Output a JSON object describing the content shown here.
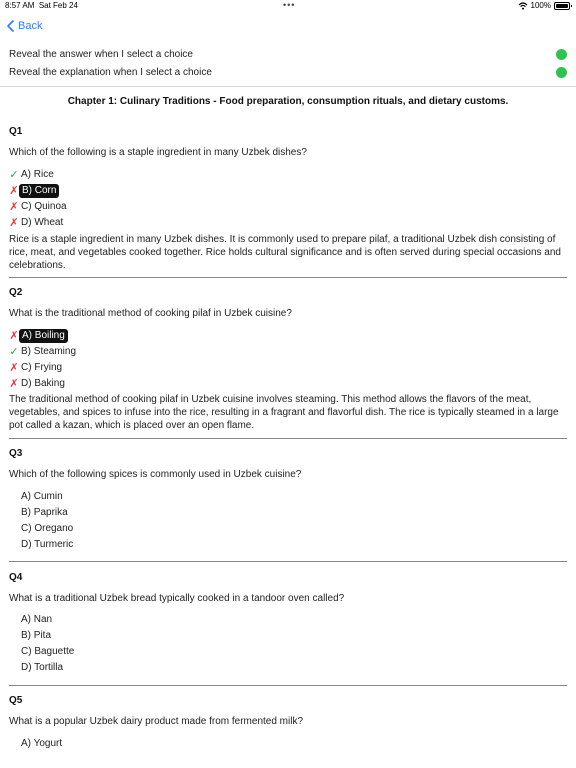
{
  "status": {
    "time": "8:57 AM",
    "date": "Sat Feb 24",
    "battery": "100%",
    "icons": [
      "wifi-icon",
      "battery-icon"
    ]
  },
  "nav": {
    "back_label": "Back"
  },
  "settings": {
    "reveal_answer": "Reveal the answer when I select a choice",
    "reveal_explanation": "Reveal the explanation when I select a choice"
  },
  "chapter_title": "Chapter 1: Culinary Traditions - Food preparation, consumption rituals, and dietary customs.",
  "colors": {
    "accent": "#2d7ef7",
    "toggle_on": "#2fc250",
    "correct": "#28a745",
    "wrong": "#e23b3b"
  },
  "questions": [
    {
      "number": "Q1",
      "text": "Which of the following is a staple ingredient in many Uzbek dishes?",
      "choices": [
        {
          "label": "A) Rice",
          "mark": "✓"
        },
        {
          "label": "B) Corn",
          "mark": "✗"
        },
        {
          "label": "C) Quinoa",
          "mark": "✗"
        },
        {
          "label": "D) Wheat",
          "mark": "✗"
        }
      ],
      "explanation": "Rice is a staple ingredient in many Uzbek dishes. It is commonly used to prepare pilaf, a traditional Uzbek dish consisting of rice, meat, and vegetables cooked together. Rice holds cultural significance and is often served during special occasions and celebrations."
    },
    {
      "number": "Q2",
      "text": "What is the traditional method of cooking pilaf in Uzbek cuisine?",
      "choices": [
        {
          "label": "A) Boiling",
          "mark": "✗"
        },
        {
          "label": "B) Steaming",
          "mark": "✓"
        },
        {
          "label": "C) Frying",
          "mark": "✗"
        },
        {
          "label": "D) Baking",
          "mark": "✗"
        }
      ],
      "explanation": "The traditional method of cooking pilaf in Uzbek cuisine involves steaming. This method allows the flavors of the meat, vegetables, and spices to infuse into the rice, resulting in a fragrant and flavorful dish. The rice is typically steamed in a large pot called a kazan, which is placed over an open flame."
    },
    {
      "number": "Q3",
      "text": "Which of the following spices is commonly used in Uzbek cuisine?",
      "choices": [
        {
          "label": "A) Cumin"
        },
        {
          "label": "B) Paprika"
        },
        {
          "label": "C) Oregano"
        },
        {
          "label": "D) Turmeric"
        }
      ]
    },
    {
      "number": "Q4",
      "text": "What is a traditional Uzbek bread typically cooked in a tandoor oven called?",
      "choices": [
        {
          "label": "A) Nan"
        },
        {
          "label": "B) Pita"
        },
        {
          "label": "C) Baguette"
        },
        {
          "label": "D) Tortilla"
        }
      ]
    },
    {
      "number": "Q5",
      "text": "What is a popular Uzbek dairy product made from fermented milk?",
      "choices": [
        {
          "label": "A) Yogurt"
        }
      ]
    }
  ]
}
